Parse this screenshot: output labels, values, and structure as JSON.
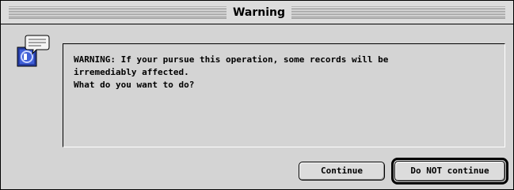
{
  "window": {
    "title": "Warning"
  },
  "icon": {
    "name": "app-icon"
  },
  "message": {
    "lines": [
      "WARNING: If your pursue this operation, some records will be",
      "irremediably affected.",
      "What do you want to do?"
    ]
  },
  "buttons": {
    "continue_label": "Continue",
    "do_not_continue_label": "Do NOT continue"
  },
  "colors": {
    "window_bg": "#d4d4d4",
    "icon_blue": "#2b46b8"
  }
}
